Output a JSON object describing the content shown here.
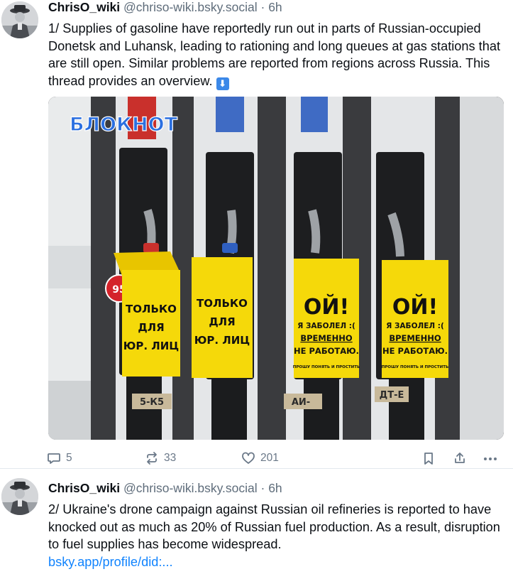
{
  "posts": [
    {
      "author_name": "ChrisO_wiki",
      "handle": "@chriso-wiki.bsky.social",
      "separator": "·",
      "time": "6h",
      "text": "1/ Supplies of gasoline have reportedly run out in parts of Russian-occupied Donetsk and Luhansk, leading to rationing and long queues at gas stations that are still open. Similar problems are reported from regions across Russia. This thread provides an overview.",
      "emoji": "⬇",
      "image": {
        "watermark": "БЛОКНОТ",
        "badge_95": "95",
        "sign_1": [
          "ТОЛЬКО",
          "ДЛЯ",
          "ЮР. ЛИЦ"
        ],
        "sign_2": [
          "ТОЛЬКО",
          "ДЛЯ",
          "ЮР. ЛИЦ"
        ],
        "sign_3": [
          "ОЙ!",
          "Я ЗАБОЛЕЛ :(",
          "ВРЕМЕННО",
          "НЕ РАБОТАЮ.",
          "ПРОШУ ПОНЯТЬ И ПРОСТИТЬ"
        ],
        "sign_4": [
          "ОЙ!",
          "Я ЗАБОЛЕЛ :(",
          "ВРЕМЕННО",
          "НЕ РАБОТАЮ.",
          "ПРОШУ ПОНЯТЬ И ПРОСТИТЬ"
        ],
        "pump_labels": [
          "5-К5",
          "АИ-",
          "ДТ-Е"
        ]
      },
      "actions": {
        "replies": "5",
        "reposts": "33",
        "likes": "201"
      }
    },
    {
      "author_name": "ChrisO_wiki",
      "handle": "@chriso-wiki.bsky.social",
      "separator": "·",
      "time": "6h",
      "text": "2/ Ukraine's drone campaign against Russian oil refineries is reported to have knocked out as much as 20% of Russian fuel production. As a result, disruption to fuel supplies has become widespread.",
      "link": "bsky.app/profile/did:..."
    }
  ],
  "colors": {
    "link": "#1083fe",
    "muted": "#5e6c7a",
    "sign_yellow": "#f5d90a"
  }
}
